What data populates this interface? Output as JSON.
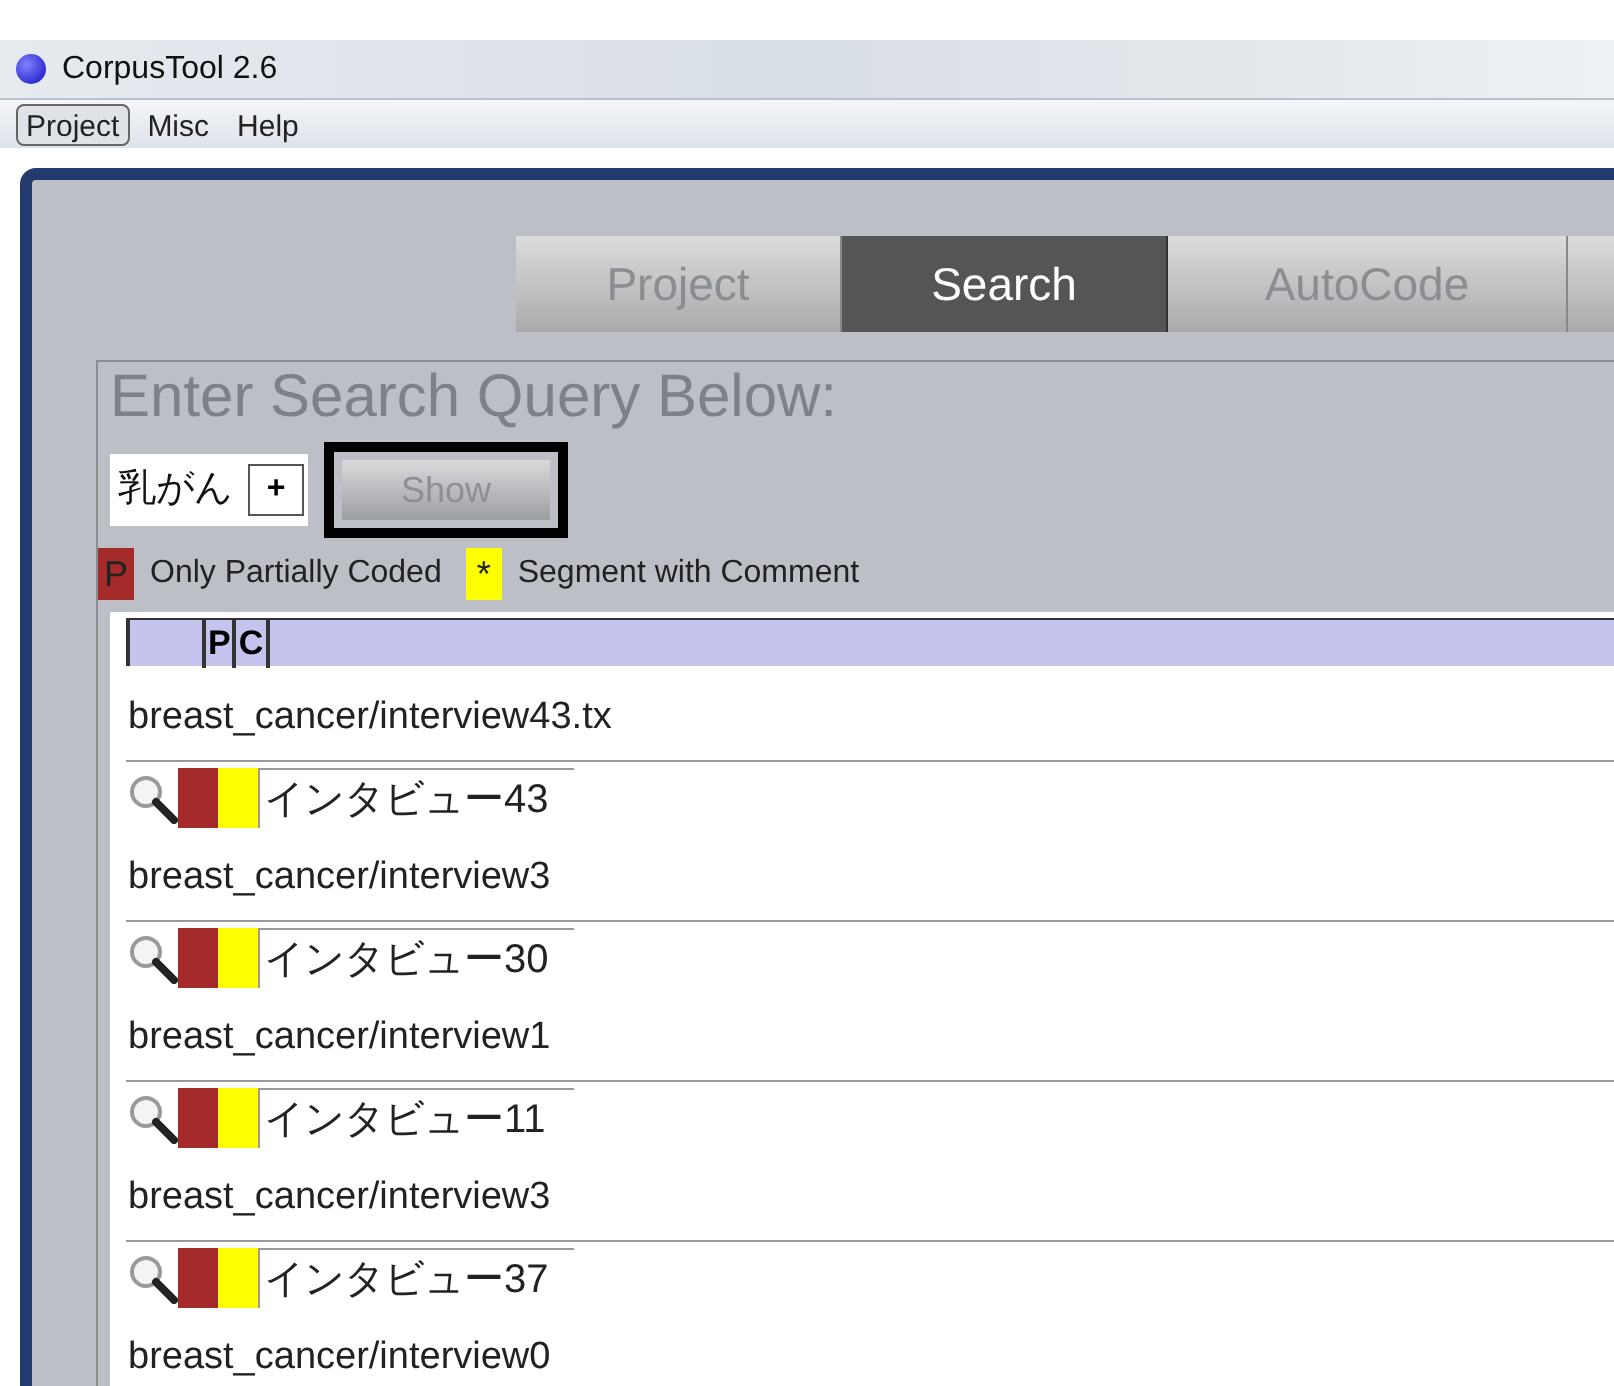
{
  "window": {
    "title": "CorpusTool 2.6"
  },
  "menu": [
    {
      "label": "Project",
      "selected": true
    },
    {
      "label": "Misc",
      "selected": false
    },
    {
      "label": "Help",
      "selected": false
    }
  ],
  "tabs": [
    {
      "label": "Project",
      "selected": false
    },
    {
      "label": "Search",
      "selected": true
    },
    {
      "label": "AutoCode",
      "selected": false
    }
  ],
  "search": {
    "heading": "Enter Search Query Below:",
    "query": "乳がん",
    "add_button": "+",
    "show_button": {
      "label": "Show",
      "focused": true
    }
  },
  "legend": [
    {
      "mark": "P",
      "text": "Only Partially Coded",
      "color": "#a52a2a"
    },
    {
      "mark": "*",
      "text": "Segment with Comment",
      "color": "#ffff00"
    }
  ],
  "table": {
    "columns": [
      "P",
      "C"
    ],
    "results": [
      {
        "file": "breast_cancer/interview43.tx",
        "hit": "インタビュー43",
        "partially_coded": true,
        "has_comment": true
      },
      {
        "file": "breast_cancer/interview3",
        "hit": "インタビュー30",
        "partially_coded": true,
        "has_comment": true
      },
      {
        "file": "breast_cancer/interview1",
        "hit": "インタビュー11",
        "partially_coded": true,
        "has_comment": true
      },
      {
        "file": "breast_cancer/interview3",
        "hit": "インタビュー37",
        "partially_coded": true,
        "has_comment": true
      },
      {
        "file": "breast_cancer/interview0"
      }
    ]
  }
}
